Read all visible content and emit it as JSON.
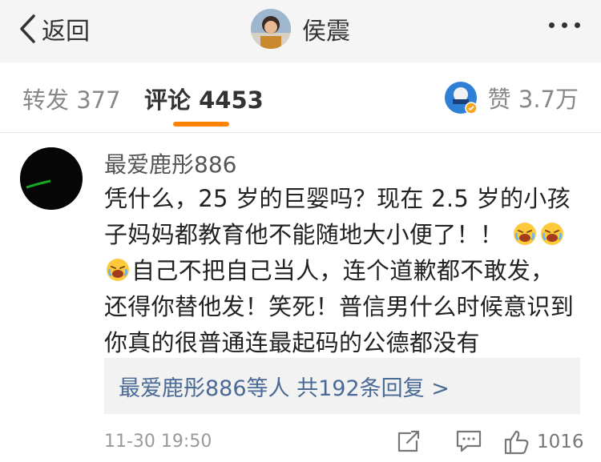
{
  "nav": {
    "back_label": "返回",
    "title": "侯震",
    "accent": "#ff8200"
  },
  "tabs": {
    "repost": "转发 377",
    "comment_label": "评论",
    "comment_count": "4453",
    "like": "赞 3.7万"
  },
  "comment": {
    "user": "最爱鹿彤886",
    "text_1": "凭什么，25 岁的巨婴吗？现在 2.5 岁的小孩子妈妈都教育他不能随地大小便了！！",
    "text_2": "自己不把自己当人，连个道歉都不敢发，还得你替他发！笑死！普信男什么时候意识到你真的很普通连最起码的公德都没有",
    "emoji_count": 3,
    "reply_summary": "最爱鹿彤886等人  共192条回复 >",
    "time": "11-30 19:50",
    "like_count": "1016"
  },
  "icons": [
    "back-chevron-icon",
    "more-icon",
    "repost-icon",
    "comment-icon",
    "thumb-up-icon",
    "crying-emoji-icon"
  ]
}
